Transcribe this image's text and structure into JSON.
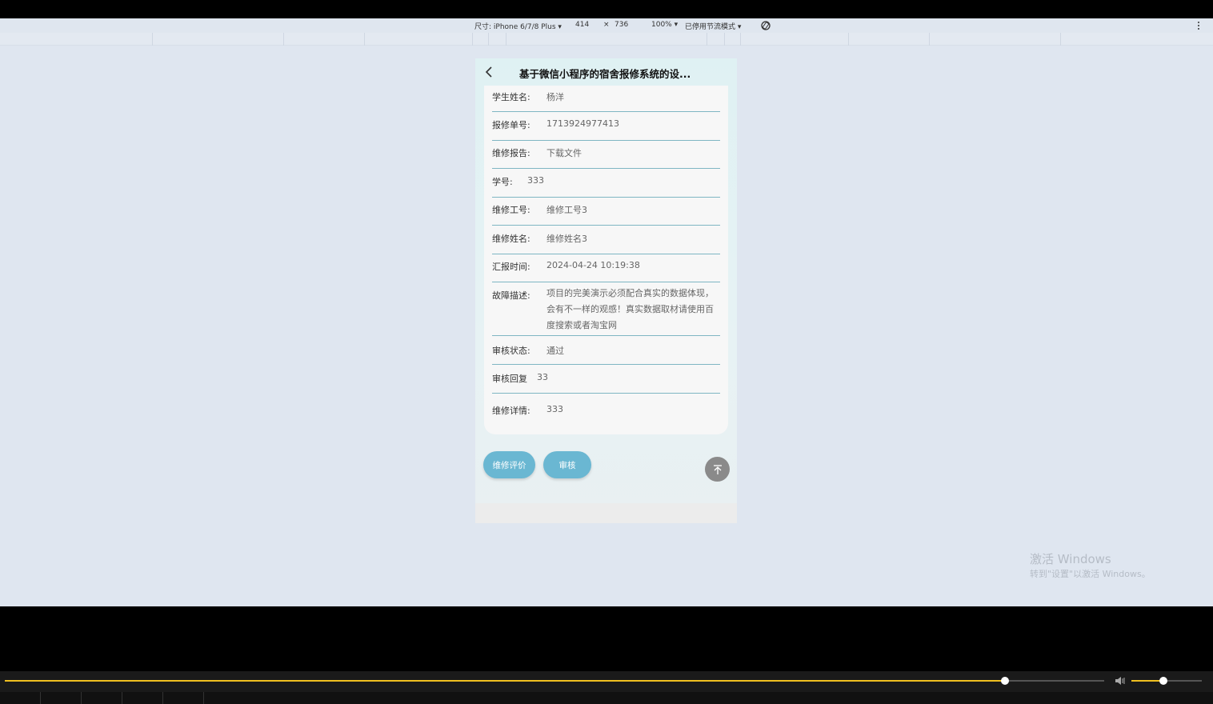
{
  "devtools": {
    "device_label": "尺寸: iPhone 6/7/8 Plus ▾",
    "width": "414",
    "times": "×",
    "height": "736",
    "zoom": "100% ▾",
    "throttle": "已停用节流模式 ▾"
  },
  "page": {
    "title": "基于微信小程序的宿舍报修系统的设..."
  },
  "fields": [
    {
      "label": "学生姓名:",
      "value": "杨洋"
    },
    {
      "label": "报修单号:",
      "value": "1713924977413"
    },
    {
      "label": "维修报告:",
      "value": "下载文件"
    },
    {
      "label": "学号:",
      "value": "333"
    },
    {
      "label": "维修工号:",
      "value": "维修工号3"
    },
    {
      "label": "维修姓名:",
      "value": "维修姓名3"
    },
    {
      "label": "汇报时间:",
      "value": "2024-04-24 10:19:38"
    },
    {
      "label": "故障描述:",
      "value": "项目的完美演示必须配合真实的数据体现，会有不一样的观感！真实数据取材请使用百度搜索或者淘宝网"
    },
    {
      "label": "审核状态:",
      "value": "通过"
    },
    {
      "label": "审核回复",
      "value": "33"
    },
    {
      "label": "维修详情:",
      "value": "333"
    }
  ],
  "buttons": {
    "evaluate": "维修评价",
    "review": "审核"
  },
  "watermark": {
    "line1": "激活 Windows",
    "line2": "转到\"设置\"以激活 Windows。"
  },
  "player": {
    "progress": 0.91,
    "volume": 0.45
  },
  "colors": {
    "accent": "#6ab7d2",
    "divider": "#7fb6c3",
    "progress": "#f0c020"
  }
}
